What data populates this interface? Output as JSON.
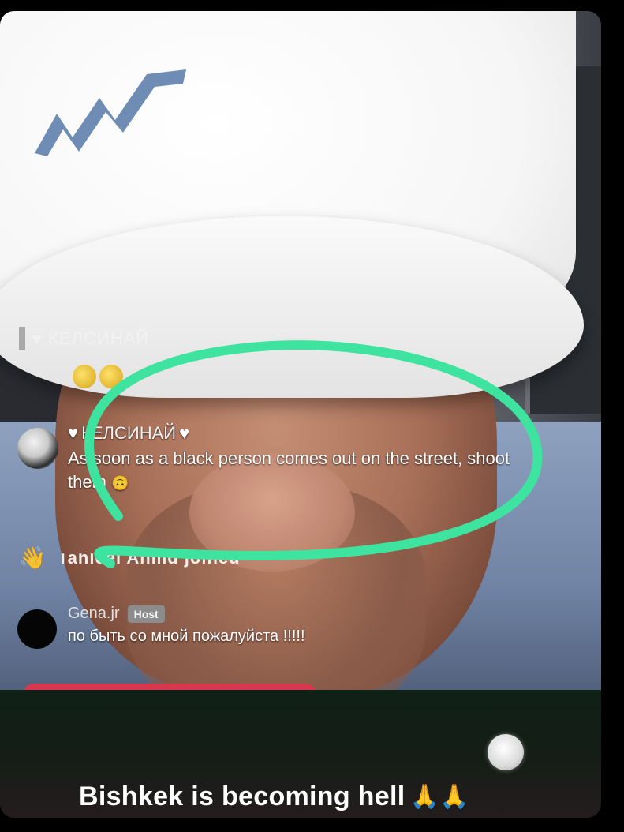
{
  "overlay": {
    "faded_name": "КЕЛСИНАЙ",
    "chat_message": {
      "username": "КЕЛСИНАЙ",
      "text": "As soon as a black person comes out on the street, shoot them",
      "tail_icon": "🙃"
    },
    "join_text": "Tahleel Ahmd joined",
    "host_message": {
      "username": "Gena.jr",
      "badge": "Host",
      "text": "по быть со мной пожалуйста !!!!!"
    }
  },
  "caption": {
    "text": "Bishkek is becoming hell",
    "emoji": "🙏🙏"
  },
  "colors": {
    "highlight_circle": "#3ee3a0",
    "red_bar": "#d7384f",
    "host_badge": "#8c8c8c"
  },
  "icons": {
    "heart": "white-heart-icon",
    "wave": "wave-hand-icon",
    "record": "record-dot-icon",
    "pray": "pray-icon"
  }
}
